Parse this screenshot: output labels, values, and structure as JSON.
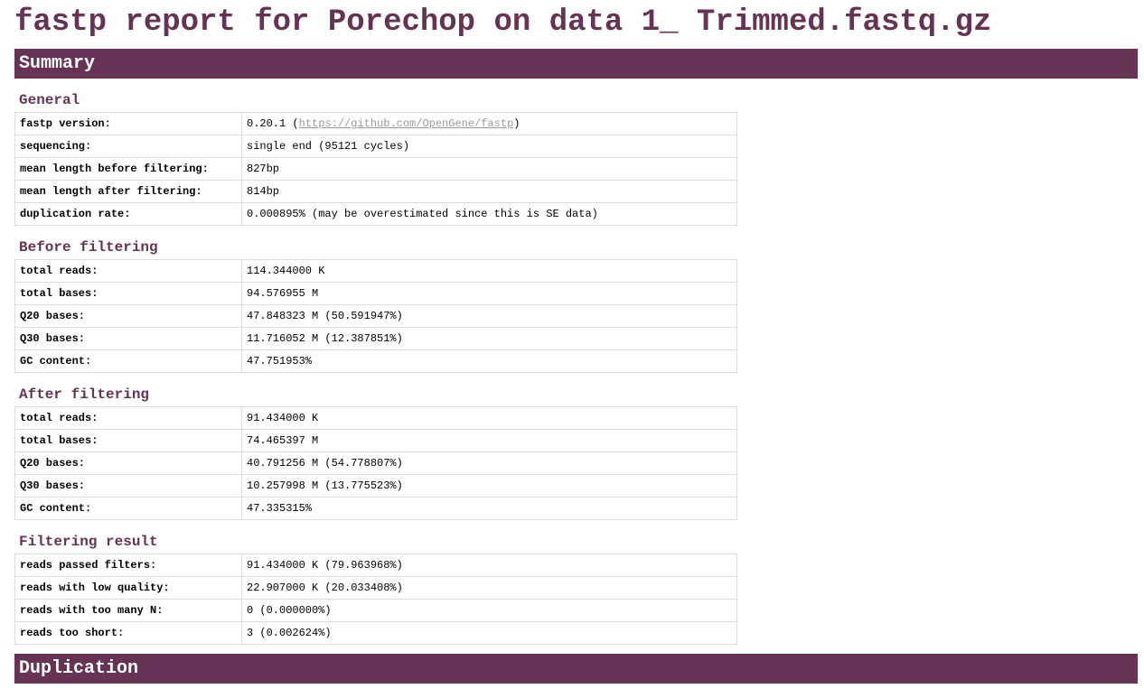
{
  "title": "fastp report for Porechop on data 1_ Trimmed.fastq.gz",
  "sections": {
    "summary": "Summary",
    "duplication": "Duplication"
  },
  "general": {
    "title": "General",
    "version_label": "fastp version:",
    "version": "0.20.1",
    "version_link": "https://github.com/OpenGene/fastp",
    "rows": [
      [
        "sequencing:",
        "single end (95121 cycles)"
      ],
      [
        "mean length before filtering:",
        "827bp"
      ],
      [
        "mean length after filtering:",
        "814bp"
      ],
      [
        "duplication rate:",
        "0.000895% (may be overestimated since this is SE data)"
      ]
    ]
  },
  "before": {
    "title": "Before filtering",
    "rows": [
      [
        "total reads:",
        "114.344000 K"
      ],
      [
        "total bases:",
        "94.576955 M"
      ],
      [
        "Q20 bases:",
        "47.848323 M (50.591947%)"
      ],
      [
        "Q30 bases:",
        "11.716052 M (12.387851%)"
      ],
      [
        "GC content:",
        "47.751953%"
      ]
    ]
  },
  "after": {
    "title": "After filtering",
    "rows": [
      [
        "total reads:",
        "91.434000 K"
      ],
      [
        "total bases:",
        "74.465397 M"
      ],
      [
        "Q20 bases:",
        "40.791256 M (54.778807%)"
      ],
      [
        "Q30 bases:",
        "10.257998 M (13.775523%)"
      ],
      [
        "GC content:",
        "47.335315%"
      ]
    ]
  },
  "result": {
    "title": "Filtering result",
    "rows": [
      [
        "reads passed filters:",
        "91.434000 K (79.963968%)"
      ],
      [
        "reads with low quality:",
        "22.907000 K (20.033408%)"
      ],
      [
        "reads with too many N:",
        "0 (0.000000%)"
      ],
      [
        "reads too short:",
        "3 (0.002624%)"
      ]
    ]
  }
}
